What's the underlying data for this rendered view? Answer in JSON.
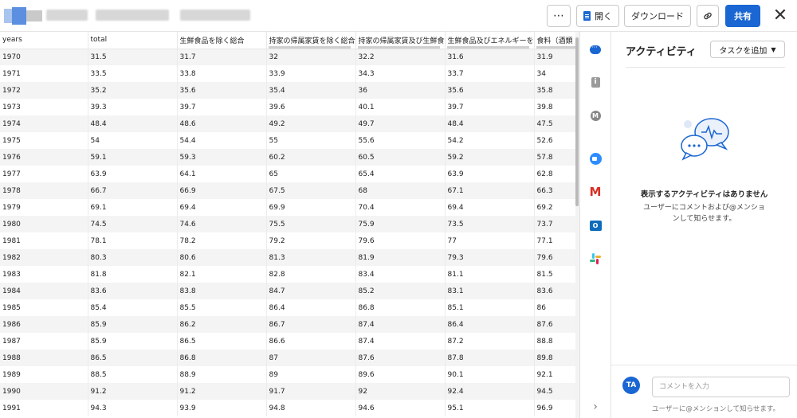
{
  "header": {
    "buttons": {
      "more": "⋯",
      "open": "開く",
      "download": "ダウンロード",
      "share": "共有",
      "close": "✕"
    }
  },
  "table": {
    "columns": [
      "years",
      "total",
      "生鮮食品を除く総合",
      "持家の帰属家賃を除く総合",
      "持家の帰属家賃及び生鮮食品を除く総合",
      "生鮮食品及びエネルギーを除く総合",
      "食料（酒類"
    ],
    "rows": [
      [
        "1970",
        "31.5",
        "31.7",
        "32",
        "32.2",
        "31.6",
        "31.9"
      ],
      [
        "1971",
        "33.5",
        "33.8",
        "33.9",
        "34.3",
        "33.7",
        "34"
      ],
      [
        "1972",
        "35.2",
        "35.6",
        "35.4",
        "36",
        "35.6",
        "35.8"
      ],
      [
        "1973",
        "39.3",
        "39.7",
        "39.6",
        "40.1",
        "39.7",
        "39.8"
      ],
      [
        "1974",
        "48.4",
        "48.6",
        "49.2",
        "49.7",
        "48.4",
        "47.5"
      ],
      [
        "1975",
        "54",
        "54.4",
        "55",
        "55.6",
        "54.2",
        "52.6"
      ],
      [
        "1976",
        "59.1",
        "59.3",
        "60.2",
        "60.5",
        "59.2",
        "57.8"
      ],
      [
        "1977",
        "63.9",
        "64.1",
        "65",
        "65.4",
        "63.9",
        "62.8"
      ],
      [
        "1978",
        "66.7",
        "66.9",
        "67.5",
        "68",
        "67.1",
        "66.3"
      ],
      [
        "1979",
        "69.1",
        "69.4",
        "69.9",
        "70.4",
        "69.4",
        "69.2"
      ],
      [
        "1980",
        "74.5",
        "74.6",
        "75.5",
        "75.9",
        "73.5",
        "73.7"
      ],
      [
        "1981",
        "78.1",
        "78.2",
        "79.2",
        "79.6",
        "77",
        "77.1"
      ],
      [
        "1982",
        "80.3",
        "80.6",
        "81.3",
        "81.9",
        "79.3",
        "79.6"
      ],
      [
        "1983",
        "81.8",
        "82.1",
        "82.8",
        "83.4",
        "81.1",
        "81.5"
      ],
      [
        "1984",
        "83.6",
        "83.8",
        "84.7",
        "85.2",
        "83.1",
        "83.6"
      ],
      [
        "1985",
        "85.4",
        "85.5",
        "86.4",
        "86.8",
        "85.1",
        "86"
      ],
      [
        "1986",
        "85.9",
        "86.2",
        "86.7",
        "87.4",
        "86.4",
        "87.6"
      ],
      [
        "1987",
        "85.9",
        "86.5",
        "86.6",
        "87.4",
        "87.2",
        "88.8"
      ],
      [
        "1988",
        "86.5",
        "86.8",
        "87",
        "87.6",
        "87.8",
        "89.8"
      ],
      [
        "1989",
        "88.5",
        "88.9",
        "89",
        "89.6",
        "90.1",
        "92.1"
      ],
      [
        "1990",
        "91.2",
        "91.2",
        "91.7",
        "92",
        "92.4",
        "94.5"
      ],
      [
        "1991",
        "94.3",
        "93.9",
        "94.8",
        "94.6",
        "95.1",
        "96.9"
      ]
    ]
  },
  "strip": {
    "icons": [
      "chat-icon",
      "info-icon",
      "m-icon",
      "zoom-icon",
      "gmail-icon",
      "outlook-icon",
      "slack-icon",
      "chevron-right-icon"
    ]
  },
  "activity": {
    "title": "アクティビティ",
    "add_task": "タスクを追加",
    "empty_title": "表示するアクティビティはありません",
    "empty_sub": "ユーザーにコメントおよび@メンションして知らせます。",
    "avatar": "TA",
    "comment_placeholder": "コメントを入力",
    "hint": "ユーザーに@メンションして知らせます。"
  },
  "colors": {
    "accent": "#1a66d2"
  }
}
